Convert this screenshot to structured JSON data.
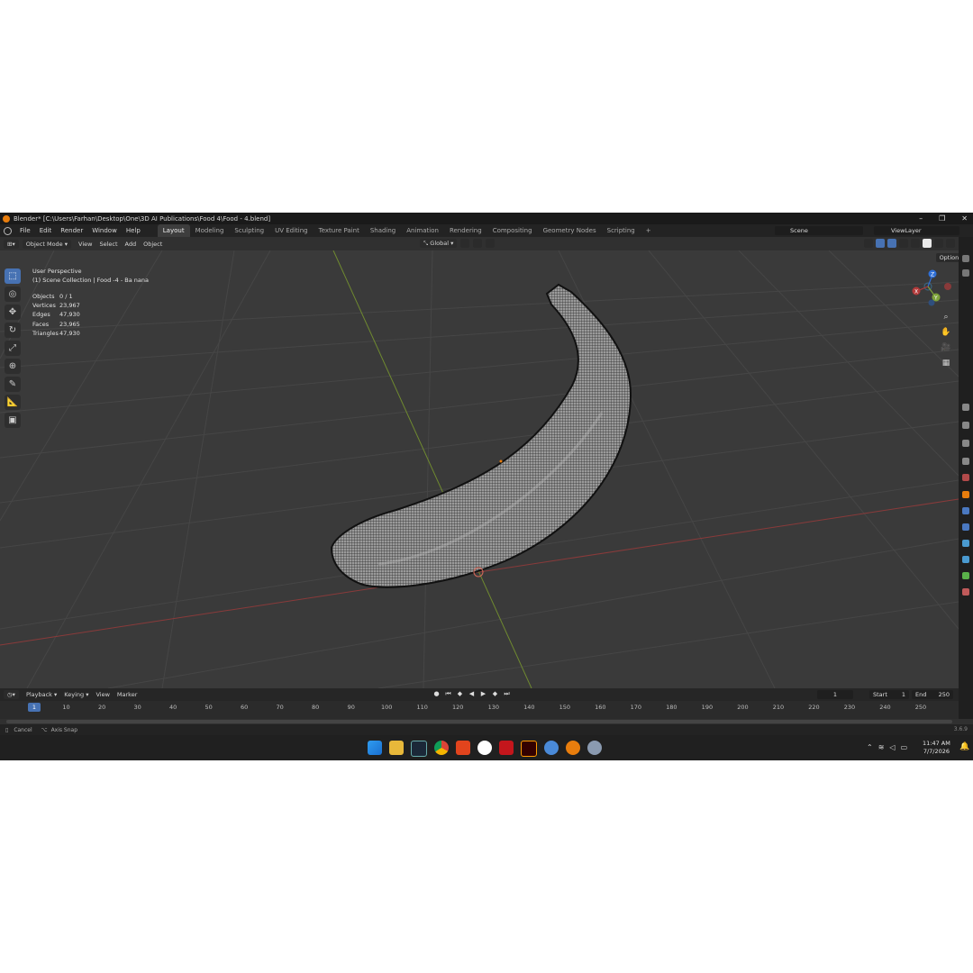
{
  "window": {
    "title": "Blender* [C:\\Users\\Farhan\\Desktop\\One\\3D AI Publications\\Food 4\\Food - 4.blend]",
    "controls": [
      "–",
      "❐",
      "✕"
    ]
  },
  "menu": [
    "File",
    "Edit",
    "Render",
    "Window",
    "Help"
  ],
  "workspaces": [
    "Layout",
    "Modeling",
    "Sculpting",
    "UV Editing",
    "Texture Paint",
    "Shading",
    "Animation",
    "Rendering",
    "Compositing",
    "Geometry Nodes",
    "Scripting",
    "+"
  ],
  "active_workspace": "Layout",
  "scene": "Scene",
  "view_layer": "ViewLayer",
  "viewport_header": {
    "mode": "Object Mode",
    "menus": [
      "View",
      "Select",
      "Add",
      "Object"
    ],
    "orientation": "Global",
    "options": "Options"
  },
  "overlay": {
    "view": "User Perspective",
    "collection": "(1) Scene Collection | Food -4 - Ba nana"
  },
  "stats": [
    {
      "label": "Objects",
      "value": "0 / 1"
    },
    {
      "label": "Vertices",
      "value": "23,967"
    },
    {
      "label": "Edges",
      "value": "47,930"
    },
    {
      "label": "Faces",
      "value": "23,965"
    },
    {
      "label": "Triangles",
      "value": "47,930"
    }
  ],
  "gizmo": {
    "x": "X",
    "y": "Y",
    "z": "Z"
  },
  "timeline": {
    "menus": [
      "Playback",
      "Keying",
      "View",
      "Marker"
    ],
    "current_frame": "1",
    "start_label": "Start",
    "start": "1",
    "end_label": "End",
    "end": "250",
    "ticks": [
      "1",
      "10",
      "20",
      "30",
      "40",
      "50",
      "60",
      "70",
      "80",
      "90",
      "100",
      "110",
      "120",
      "130",
      "140",
      "150",
      "160",
      "170",
      "180",
      "190",
      "200",
      "210",
      "220",
      "230",
      "240",
      "250"
    ]
  },
  "statusbar": {
    "cancel": "Cancel",
    "axis_snap": "Axis Snap",
    "version": "3.6.9"
  },
  "taskbar": {
    "time": "11:47 AM",
    "date": "7/7/2026"
  },
  "colors": {
    "accent": "#4772b3",
    "x_axis": "#b33a3a",
    "y_axis": "#7ea23a",
    "z_axis": "#2f6fd6",
    "orange": "#e87d0d"
  }
}
